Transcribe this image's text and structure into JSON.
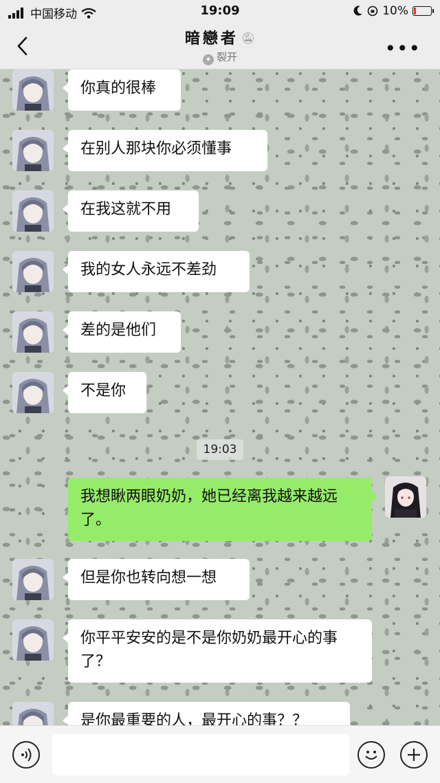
{
  "status_bar": {
    "carrier": "中国移动",
    "time": "19:09",
    "battery": "10%"
  },
  "nav": {
    "title": "暗戀者",
    "subtitle": "裂开"
  },
  "messages": [
    {
      "side": "left",
      "text": "你真的很棒"
    },
    {
      "side": "left",
      "text": "在别人那块你必须懂事"
    },
    {
      "side": "left",
      "text": "在我这就不用"
    },
    {
      "side": "left",
      "text": "我的女人永远不差劲"
    },
    {
      "side": "left",
      "text": "差的是他们"
    },
    {
      "side": "left",
      "text": "不是你"
    },
    {
      "side": "right",
      "text": "我想瞅两眼奶奶，她已经离我越来越远了。"
    },
    {
      "side": "left",
      "text": "但是你也转向想一想"
    },
    {
      "side": "left",
      "text": "你平平安安的是不是你奶奶最开心的事了？"
    },
    {
      "side": "left",
      "text": "是你最重要的人，最开心的事？？"
    }
  ],
  "timestamp": "19:03",
  "icons": {
    "back": "chevron-left-icon",
    "mute": "bell-slash-icon",
    "more": "more-icon",
    "voice": "voice-icon",
    "emoji": "emoji-icon",
    "add": "plus-icon"
  },
  "colors": {
    "sent_bubble": "#95ec69",
    "received_bubble": "#ffffff",
    "battery_low": "#e0332e"
  }
}
